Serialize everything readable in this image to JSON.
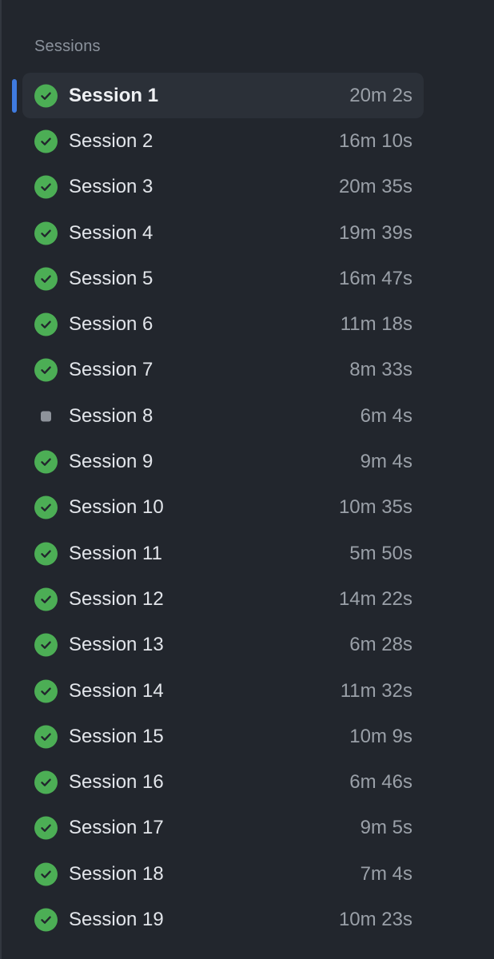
{
  "sidebar": {
    "title": "Sessions",
    "status_colors": {
      "completed": "#4cae55",
      "stopped": "#8e939b",
      "accent": "#3f7be0"
    },
    "selected_index": 0,
    "sessions": [
      {
        "label": "Session 1",
        "duration": "20m 2s",
        "status": "completed"
      },
      {
        "label": "Session 2",
        "duration": "16m 10s",
        "status": "completed"
      },
      {
        "label": "Session 3",
        "duration": "20m 35s",
        "status": "completed"
      },
      {
        "label": "Session 4",
        "duration": "19m 39s",
        "status": "completed"
      },
      {
        "label": "Session 5",
        "duration": "16m 47s",
        "status": "completed"
      },
      {
        "label": "Session 6",
        "duration": "11m 18s",
        "status": "completed"
      },
      {
        "label": "Session 7",
        "duration": "8m 33s",
        "status": "completed"
      },
      {
        "label": "Session 8",
        "duration": "6m 4s",
        "status": "stopped"
      },
      {
        "label": "Session 9",
        "duration": "9m 4s",
        "status": "completed"
      },
      {
        "label": "Session 10",
        "duration": "10m 35s",
        "status": "completed"
      },
      {
        "label": "Session 11",
        "duration": "5m 50s",
        "status": "completed"
      },
      {
        "label": "Session 12",
        "duration": "14m 22s",
        "status": "completed"
      },
      {
        "label": "Session 13",
        "duration": "6m 28s",
        "status": "completed"
      },
      {
        "label": "Session 14",
        "duration": "11m 32s",
        "status": "completed"
      },
      {
        "label": "Session 15",
        "duration": "10m 9s",
        "status": "completed"
      },
      {
        "label": "Session 16",
        "duration": "6m 46s",
        "status": "completed"
      },
      {
        "label": "Session 17",
        "duration": "9m 5s",
        "status": "completed"
      },
      {
        "label": "Session 18",
        "duration": "7m 4s",
        "status": "completed"
      },
      {
        "label": "Session 19",
        "duration": "10m 23s",
        "status": "completed"
      }
    ]
  }
}
